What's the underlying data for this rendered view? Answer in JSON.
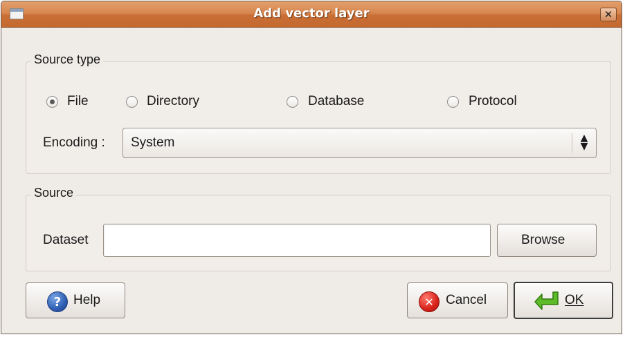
{
  "window": {
    "title": "Add vector layer",
    "close_glyph": "✕"
  },
  "source_type": {
    "group_title": "Source type",
    "options": [
      {
        "label": "File",
        "checked": true
      },
      {
        "label": "Directory",
        "checked": false
      },
      {
        "label": "Database",
        "checked": false
      },
      {
        "label": "Protocol",
        "checked": false
      }
    ],
    "encoding_label": "Encoding :",
    "encoding_value": "System"
  },
  "source": {
    "group_title": "Source",
    "dataset_label": "Dataset",
    "dataset_value": "",
    "browse_label": "Browse"
  },
  "buttons": {
    "help_label": "Help",
    "cancel_label": "Cancel",
    "ok_label": "OK"
  },
  "icons": {
    "help": "question-mark-icon",
    "cancel": "cancel-x-icon",
    "ok": "green-enter-arrow-icon"
  },
  "colors": {
    "titlebar": "#d8874f",
    "dialog_bg": "#efebe7"
  }
}
